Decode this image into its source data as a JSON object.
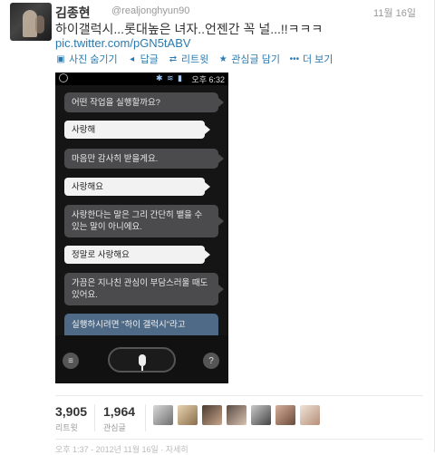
{
  "tweet": {
    "name": "김종현",
    "handle": "@realjonghyun90",
    "date": "11월 16일",
    "text": "하이갤럭시...롯대높은 녀자..언젠간 꼭 널...!!ㅋㅋㅋ",
    "link": "pic.twitter.com/pGN5tABV"
  },
  "actions": [
    {
      "icon": "photo-icon",
      "label": "사진 숨기기"
    },
    {
      "icon": "reply-icon",
      "label": "답글"
    },
    {
      "icon": "retweet-icon",
      "label": "리트윗"
    },
    {
      "icon": "star-icon",
      "label": "관심글 담기"
    },
    {
      "icon": "more-icon",
      "label": "더 보기"
    }
  ],
  "phone": {
    "time": "오후 6:32",
    "messages": [
      {
        "type": "dark",
        "text": "어떤 작업을 실행할까요?"
      },
      {
        "type": "light",
        "text": "사랑해"
      },
      {
        "type": "dark",
        "text": "마음만 감사히 받을게요."
      },
      {
        "type": "light",
        "text": "사랑해요"
      },
      {
        "type": "dark",
        "text": "사랑한다는 말은 그리 간단히 뱉을 수 있는 말이 아니에요."
      },
      {
        "type": "light",
        "text": "정말로 사랑해요"
      },
      {
        "type": "dark",
        "text": "가끔은 지나친 관심이 부담스러울 때도 있어요."
      },
      {
        "type": "blue",
        "text": "실행하시려면 \"하이 갤럭시\"라고"
      }
    ],
    "left_button": "≡",
    "help_button": "?"
  },
  "stats": {
    "retweets": "3,905",
    "retweets_label": "리트윗",
    "favorites": "1,964",
    "favorites_label": "관심글"
  },
  "footer": "오후 1:37 - 2012년 11월 16일 · 자세히"
}
